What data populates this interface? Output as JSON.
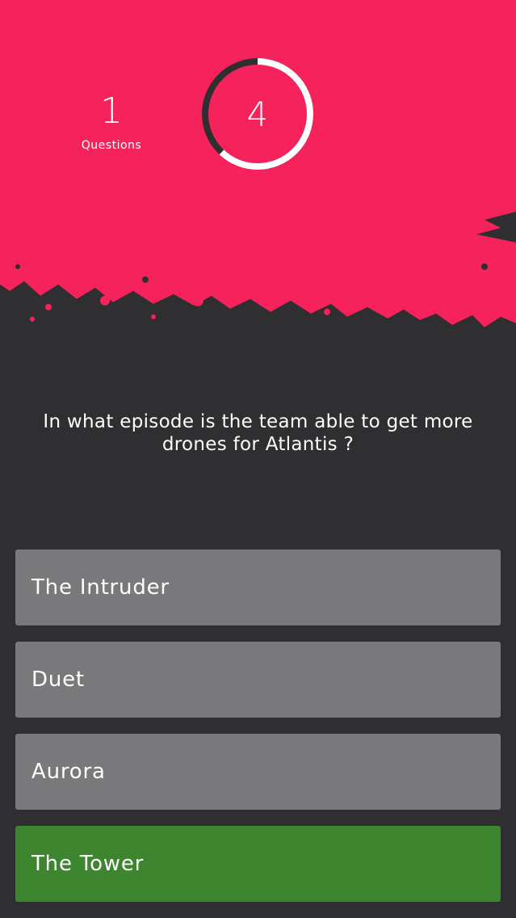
{
  "colors": {
    "header_pink": "#f6225b",
    "background_dark": "#2f2e30",
    "answer_gray": "#79787b",
    "answer_correct_green": "#3d862f"
  },
  "status": {
    "question_number": "1",
    "question_label": "Questions",
    "timer_value": "4",
    "timer_progress": 0.62
  },
  "question": {
    "text": "In what episode is the team able to get more drones for Atlantis ?"
  },
  "answers": [
    {
      "label": "The Intruder",
      "state": "default"
    },
    {
      "label": "Duet",
      "state": "default"
    },
    {
      "label": "Aurora",
      "state": "default"
    },
    {
      "label": "The Tower",
      "state": "correct"
    }
  ]
}
